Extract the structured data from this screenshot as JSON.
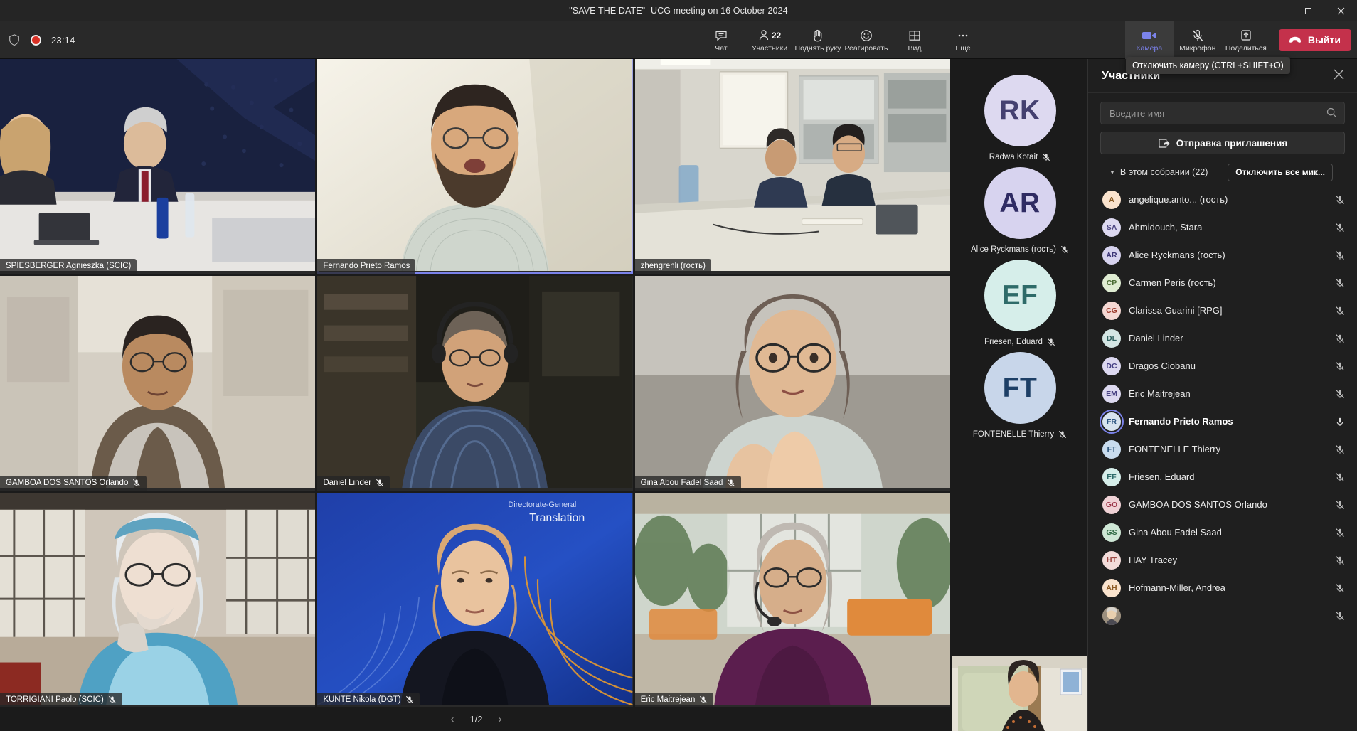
{
  "window": {
    "title": "\"SAVE THE DATE\"- UCG meeting on 16 October 2024",
    "minimize_label": "−",
    "restore_label": "❐",
    "close_label": "✕"
  },
  "status": {
    "shield_icon": "shield-icon",
    "recording_icon": "recording-dot-icon",
    "elapsed": "23:14"
  },
  "toolbar": {
    "items": [
      {
        "label": "Чат",
        "icon": "chat-icon",
        "badge": ""
      },
      {
        "label": "Участники",
        "icon": "people-icon",
        "badge": "22"
      },
      {
        "label": "Поднять руку",
        "icon": "raise-hand-icon",
        "badge": ""
      },
      {
        "label": "Реагировать",
        "icon": "reactions-icon",
        "badge": ""
      },
      {
        "label": "Вид",
        "icon": "view-grid-icon",
        "badge": ""
      },
      {
        "label": "Еще",
        "icon": "more-ellipsis-icon",
        "badge": ""
      }
    ],
    "device_items": [
      {
        "label": "Камера",
        "icon": "camera-icon",
        "active": true
      },
      {
        "label": "Микрофон",
        "icon": "microphone-muted-icon",
        "active": false
      },
      {
        "label": "Поделиться",
        "icon": "share-up-arrow-icon",
        "active": false
      }
    ],
    "leave_label": "Выйти",
    "leave_icon": "phone-hangup-icon",
    "leave_color": "#c4314b"
  },
  "tooltip": {
    "text": "Отключить камеру (CTRL+SHIFT+O)"
  },
  "stage": {
    "active_speaker_color": "#7b83eb",
    "tiles": [
      {
        "name": "SPIESBERGER Agnieszka (SCIC)",
        "muted": false,
        "label_pos": "bottom",
        "active": false,
        "scene": "council-room"
      },
      {
        "name": "Fernando Prieto Ramos",
        "muted": false,
        "label_pos": "bottom",
        "active": true,
        "scene": "bearded-man"
      },
      {
        "name": "zhengrenli (гость)",
        "muted": false,
        "label_pos": "bottom",
        "active": false,
        "scene": "lab-room"
      },
      {
        "name": "GAMBOA DOS SANTOS Orlando",
        "muted": true,
        "label_pos": "bottom",
        "active": false,
        "scene": "office-man"
      },
      {
        "name": "Daniel Linder",
        "muted": true,
        "label_pos": "bottom",
        "active": false,
        "scene": "headset-man"
      },
      {
        "name": "Gina Abou Fadel Saad",
        "muted": true,
        "label_pos": "bottom",
        "active": false,
        "scene": "glasses-woman"
      },
      {
        "name": "TORRIGIANI Paolo (SCIC)",
        "muted": true,
        "label_pos": "bottom",
        "active": false,
        "scene": "loft-man"
      },
      {
        "name": "KUNTE Nikola (DGT)",
        "muted": true,
        "label_pos": "bottom",
        "active": false,
        "scene": "dgt-background",
        "bg_text_1": "Directorate-General",
        "bg_text_2": "Translation"
      },
      {
        "name": "Eric Maitrejean",
        "muted": true,
        "label_pos": "bottom",
        "active": false,
        "scene": "terrace-man"
      }
    ],
    "pagination": {
      "prev": "‹",
      "page": "1/2",
      "next": "›"
    }
  },
  "avatar_column": [
    {
      "initials": "RK",
      "name": "Radwa Kotait",
      "muted": true,
      "bg": "#ddd9f0",
      "fg": "#444070"
    },
    {
      "initials": "AR",
      "name": "Alice Ryckmans (гость)",
      "muted": true,
      "bg": "#d7d3ef",
      "fg": "#2f2b63"
    },
    {
      "initials": "EF",
      "name": "Friesen, Eduard",
      "muted": true,
      "bg": "#d6eeea",
      "fg": "#2e6b69"
    },
    {
      "initials": "FT",
      "name": "FONTENELLE Thierry",
      "muted": true,
      "bg": "#c8d6ea",
      "fg": "#1d3f66"
    }
  ],
  "panel": {
    "title": "Участники",
    "close_icon": "close-icon",
    "search": {
      "placeholder": "Введите имя",
      "value": "",
      "icon": "search-icon"
    },
    "invite": {
      "label": "Отправка приглашения",
      "icon": "share-invite-icon"
    },
    "section": {
      "label": "В этом собрании (22)",
      "caret_icon": "chevron-down-icon"
    },
    "mute_all": {
      "label": "Отключить все мик..."
    },
    "participants": [
      {
        "initials": "A",
        "name": "angelique.anto... (гость)",
        "muted": true,
        "bg": "#fae3cd",
        "fg": "#8a5a22",
        "speaking": false
      },
      {
        "initials": "SA",
        "name": "Ahmidouch, Stara",
        "muted": true,
        "bg": "#ddd9f0",
        "fg": "#4a4380",
        "speaking": false
      },
      {
        "initials": "AR",
        "name": "Alice Ryckmans (гость)",
        "muted": true,
        "bg": "#d7d3ef",
        "fg": "#3b3476",
        "speaking": false
      },
      {
        "initials": "CP",
        "name": "Carmen Peris (гость)",
        "muted": true,
        "bg": "#dfecd2",
        "fg": "#4a6b33",
        "speaking": false
      },
      {
        "initials": "CG",
        "name": "Clarissa Guarini [RPG]",
        "muted": true,
        "bg": "#f5d8d3",
        "fg": "#9c3a2c",
        "speaking": false
      },
      {
        "initials": "DL",
        "name": "Daniel Linder",
        "muted": true,
        "bg": "#d4e6e4",
        "fg": "#2f6260",
        "speaking": false
      },
      {
        "initials": "DC",
        "name": "Dragos Ciobanu",
        "muted": true,
        "bg": "#dcd8f0",
        "fg": "#443e84",
        "speaking": false
      },
      {
        "initials": "EM",
        "name": "Eric Maitrejean",
        "muted": true,
        "bg": "#ddd9f0",
        "fg": "#494283",
        "speaking": false
      },
      {
        "initials": "FR",
        "name": "Fernando Prieto Ramos",
        "muted": false,
        "bg": "#d7e3ef",
        "fg": "#2c5480",
        "speaking": true
      },
      {
        "initials": "FT",
        "name": "FONTENELLE Thierry",
        "muted": true,
        "bg": "#c9dcee",
        "fg": "#1f4a72",
        "speaking": false
      },
      {
        "initials": "EF",
        "name": "Friesen, Eduard",
        "muted": true,
        "bg": "#d6eeea",
        "fg": "#2e6b69",
        "speaking": false
      },
      {
        "initials": "GO",
        "name": "GAMBOA DOS SANTOS Orlando",
        "muted": true,
        "bg": "#f0d2d6",
        "fg": "#9b3448",
        "speaking": false
      },
      {
        "initials": "GS",
        "name": "Gina Abou Fadel Saad",
        "muted": true,
        "bg": "#cfe8d6",
        "fg": "#2f6a44",
        "speaking": false
      },
      {
        "initials": "HT",
        "name": "HAY Tracey",
        "muted": true,
        "bg": "#f3dcda",
        "fg": "#9b4640",
        "speaking": false
      },
      {
        "initials": "AH",
        "name": "Hofmann-Miller, Andrea",
        "muted": true,
        "bg": "#fae3cd",
        "fg": "#8d5a22",
        "speaking": false
      },
      {
        "initials": "",
        "name": "",
        "muted": true,
        "bg": "#8a7f72",
        "fg": "#ffffff",
        "speaking": false,
        "photo": true
      }
    ]
  }
}
